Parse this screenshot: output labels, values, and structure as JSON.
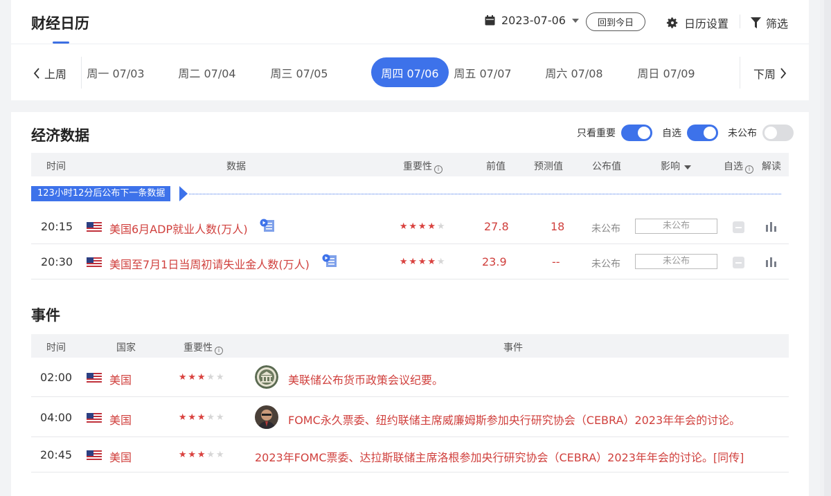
{
  "header": {
    "title": "财经日历",
    "date": "2023-07-06",
    "today_button": "回到今日",
    "settings_label": "日历设置",
    "filter_label": "筛选"
  },
  "week_nav": {
    "prev_label": "上周",
    "next_label": "下周",
    "days": [
      {
        "label": "周一 07/03",
        "active": false
      },
      {
        "label": "周二 07/04",
        "active": false
      },
      {
        "label": "周三 07/05",
        "active": false
      },
      {
        "label": "周四 07/06",
        "active": true
      },
      {
        "label": "周五 07/07",
        "active": false
      },
      {
        "label": "周六 07/08",
        "active": false
      },
      {
        "label": "周日 07/09",
        "active": false
      }
    ]
  },
  "economic": {
    "title": "经济数据",
    "toggles": [
      {
        "label": "只看重要",
        "on": true
      },
      {
        "label": "自选",
        "on": true
      },
      {
        "label": "未公布",
        "on": false
      }
    ],
    "columns": {
      "time": "时间",
      "data": "数据",
      "importance": "重要性",
      "previous": "前值",
      "forecast": "预测值",
      "actual": "公布值",
      "impact": "影响",
      "watch": "自选",
      "interpret": "解读"
    },
    "next_release": "123小时12分后公布下一条数据",
    "rows": [
      {
        "time": "20:15",
        "country": "US",
        "name": "美国6月ADP就业人数(万人)",
        "stars": 4,
        "previous": "27.8",
        "forecast": "18",
        "actual": "未公布",
        "impact": "未公布"
      },
      {
        "time": "20:30",
        "country": "US",
        "name": "美国至7月1日当周初请失业金人数(万人)",
        "stars": 4,
        "previous": "23.9",
        "forecast": "--",
        "actual": "未公布",
        "impact": "未公布"
      }
    ]
  },
  "events": {
    "title": "事件",
    "columns": {
      "time": "时间",
      "country": "国家",
      "importance": "重要性",
      "event": "事件"
    },
    "rows": [
      {
        "time": "02:00",
        "country": "美国",
        "stars": 3,
        "avatar": "fed-seal",
        "text": "美联储公布货币政策会议纪要。"
      },
      {
        "time": "04:00",
        "country": "美国",
        "stars": 3,
        "avatar": "person-photo",
        "text": "FOMC永久票委、纽约联储主席威廉姆斯参加央行研究协会（CEBRA）2023年年会的讨论。"
      },
      {
        "time": "20:45",
        "country": "美国",
        "stars": 3,
        "avatar": "",
        "text": "2023年FOMC票委、达拉斯联储主席洛根参加央行研究协会（CEBRA）2023年年会的讨论。[同传]"
      }
    ]
  },
  "colors": {
    "accent": "#3d72ea",
    "red_text": "#d0403d",
    "star_on": "#d9423f",
    "star_off": "#d6d6d6"
  }
}
